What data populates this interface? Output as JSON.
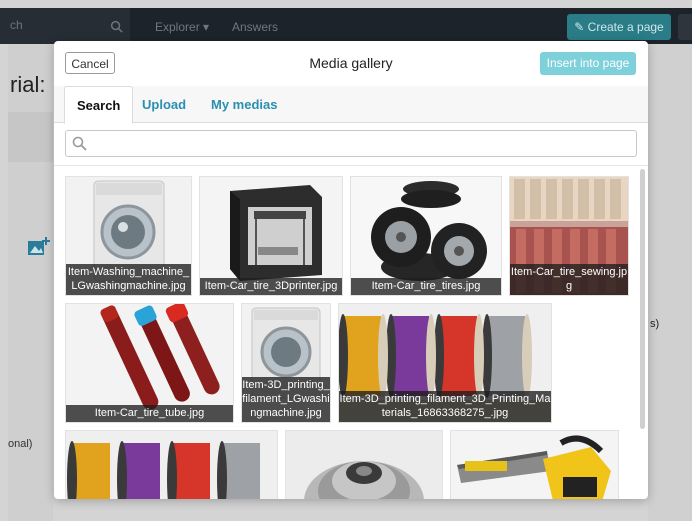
{
  "background": {
    "search_placeholder": "ch",
    "nav": [
      "Explorer ▾",
      "Answers"
    ],
    "create_page": "Create a page",
    "page_title_fragment": "rial:",
    "left_label": "onal)",
    "right_text": "s)"
  },
  "modal": {
    "cancel": "Cancel",
    "title": "Media gallery",
    "insert": "Insert into page",
    "tabs": [
      {
        "label": "Search",
        "active": true
      },
      {
        "label": "Upload",
        "active": false
      },
      {
        "label": "My medias",
        "active": false
      }
    ],
    "search": {
      "value": "",
      "placeholder": ""
    },
    "items": [
      {
        "caption": "Item-Washing_machine_LGwashingmachine.jpg",
        "icon": "washing-machine-image"
      },
      {
        "caption": "Item-Car_tire_3Dprinter.jpg",
        "icon": "3d-printer-image"
      },
      {
        "caption": "Item-Car_tire_tires.jpg",
        "icon": "tires-image"
      },
      {
        "caption": "Item-Car_tire_sewing.jpg",
        "icon": "sewing-threads-image"
      },
      {
        "caption": "Item-Car_tire_tube.jpg",
        "icon": "test-tubes-image"
      },
      {
        "caption": "Item-3D_printing_filament_LGwashingmachine.jpg",
        "icon": "washing-machine-image"
      },
      {
        "caption": "Item-3D_printing_filament_3D_Printing_Materials_16863368275_.jpg",
        "icon": "filament-spools-image"
      },
      {
        "caption": "",
        "icon": "filament-spools-image"
      },
      {
        "caption": "",
        "icon": "bike-cassette-image"
      },
      {
        "caption": "",
        "icon": "chainsaw-image"
      }
    ]
  },
  "colors": {
    "accent": "#2a8fb0",
    "insert_button": "#7ed0da",
    "topbar": "#1c232b"
  }
}
